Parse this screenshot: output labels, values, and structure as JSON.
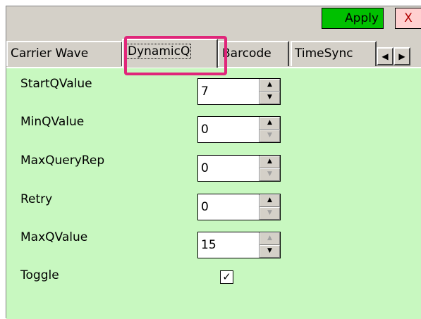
{
  "toolbar": {
    "apply_label": "Apply",
    "close_label": "X"
  },
  "tabs": [
    {
      "label": "Carrier Wave",
      "active": false
    },
    {
      "label": "DynamicQ",
      "active": true
    },
    {
      "label": "Barcode",
      "active": false
    },
    {
      "label": "TimeSync",
      "active": false
    }
  ],
  "tab_scroll": {
    "left": "◀",
    "right": "▶"
  },
  "fields": [
    {
      "label": "StartQValue",
      "value": "7"
    },
    {
      "label": "MinQValue",
      "value": "0"
    },
    {
      "label": "MaxQueryRep",
      "value": "0"
    },
    {
      "label": "Retry",
      "value": "0"
    },
    {
      "label": "MaxQValue",
      "value": "15"
    }
  ],
  "toggle": {
    "label": "Toggle",
    "checked": true,
    "mark": "✓"
  },
  "colors": {
    "panel_bg": "#c8f8c0",
    "apply_bg": "#00c000",
    "highlight": "#e0267a"
  }
}
